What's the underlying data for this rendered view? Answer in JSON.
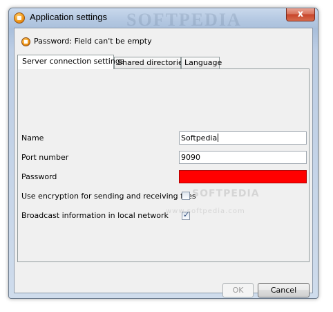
{
  "window": {
    "title": "Application settings",
    "watermark": "SOFTPEDIA",
    "close_label": "x"
  },
  "status": {
    "message": "Password: Field can't be empty"
  },
  "tabs": [
    {
      "label": "Server connection settings",
      "active": true
    },
    {
      "label": "Shared directories",
      "active": false
    },
    {
      "label": "Language",
      "active": false
    }
  ],
  "form": {
    "name": {
      "label": "Name",
      "value": "Softpedia"
    },
    "port": {
      "label": "Port number",
      "value": "9090"
    },
    "password": {
      "label": "Password",
      "value": "",
      "error_color": "#ff0000"
    },
    "encryption": {
      "label": "Use encryption for sending and receiving files",
      "checked": false
    },
    "broadcast": {
      "label": "Broadcast information in local network",
      "checked": true
    }
  },
  "buttons": {
    "ok": {
      "label": "OK",
      "enabled": false
    },
    "cancel": {
      "label": "Cancel",
      "enabled": true
    }
  },
  "watermarks": {
    "panel_1": "SOFTPEDIA",
    "panel_2": "www.softpedia.com"
  },
  "icons": {
    "app": "app-logo-icon",
    "status": "error-icon",
    "check": "checkmark-icon"
  }
}
